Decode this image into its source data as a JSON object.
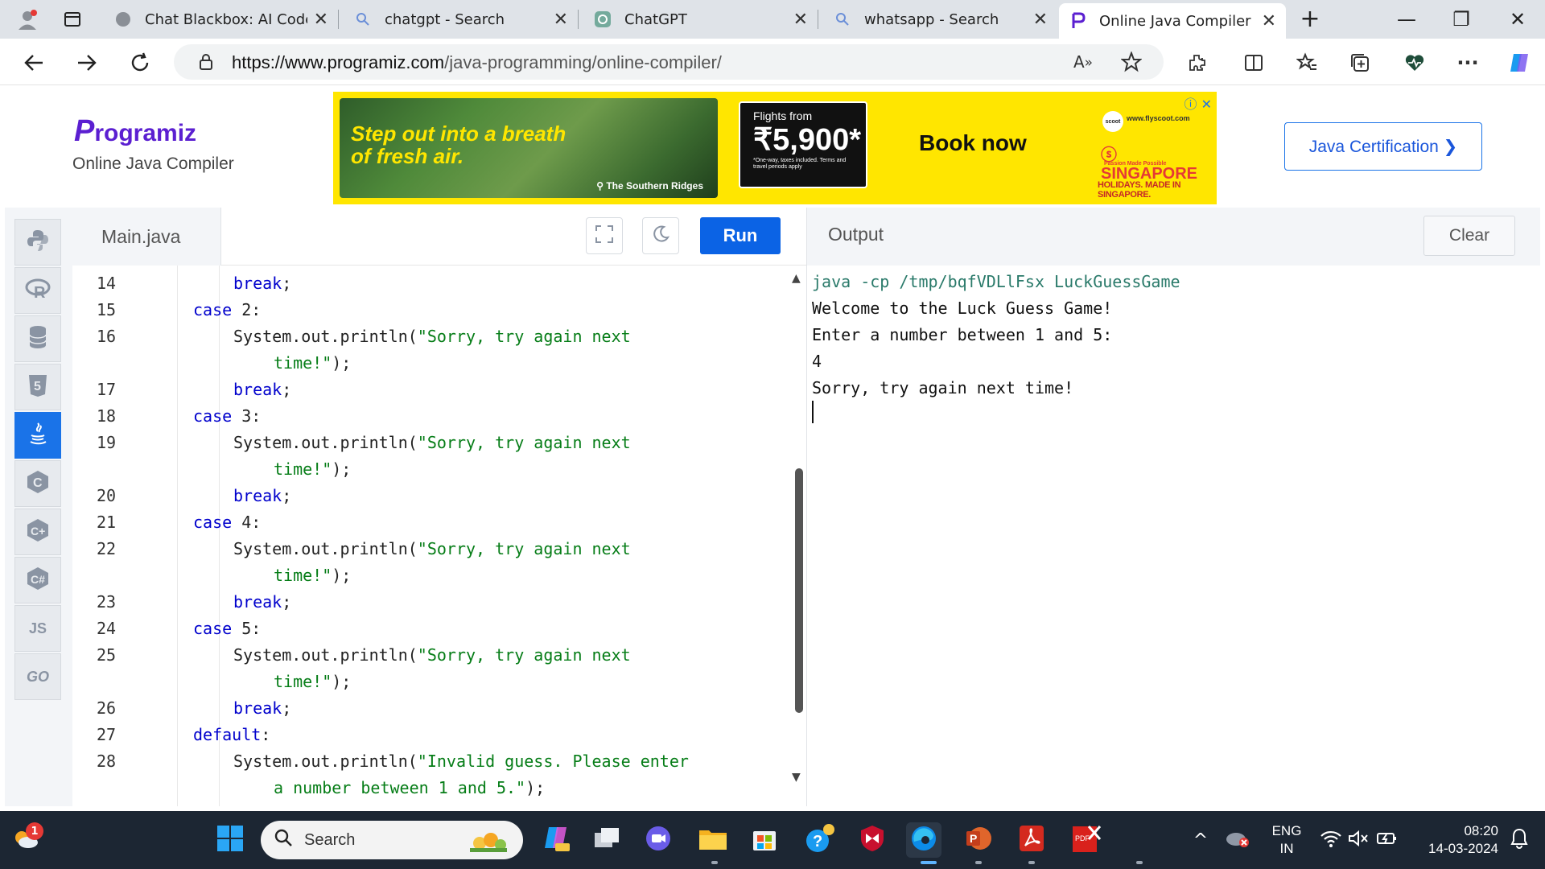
{
  "browser": {
    "tabs": [
      {
        "label": "Chat Blackbox: AI Code C",
        "icon": "blackbox-icon"
      },
      {
        "label": "chatgpt - Search",
        "icon": "search-icon"
      },
      {
        "label": "ChatGPT",
        "icon": "chatgpt-icon"
      },
      {
        "label": "whatsapp - Search",
        "icon": "search-icon"
      },
      {
        "label": "Online Java Compiler",
        "icon": "programiz-icon",
        "active": true
      }
    ],
    "url_host": "https://www.programiz.com",
    "url_path": "/java-programming/online-compiler/"
  },
  "header": {
    "logo_p": "P",
    "logo_rest": "rogramiz",
    "subtitle": "Online Java Compiler",
    "cert_button": "Java Certification ❯"
  },
  "ad": {
    "headline": "Step out into a breath of fresh air.",
    "location": "The Southern Ridges",
    "flights_from": "Flights from",
    "price": "₹5,900*",
    "fine_print": "*One-way, taxes included. Terms and travel periods apply",
    "cta": "Book now",
    "scoot": "scoot",
    "brand_url": "www.flyscoot.com",
    "brand": "SINGAPORE",
    "brand_tag": "Passion Made Possible",
    "holidays": "HOLIDAYS. MADE IN SINGAPORE."
  },
  "sidebar": {
    "languages": [
      {
        "name": "python",
        "icon": "python-icon"
      },
      {
        "name": "r",
        "icon": "r-icon"
      },
      {
        "name": "sql",
        "icon": "database-icon"
      },
      {
        "name": "html",
        "icon": "html5-icon"
      },
      {
        "name": "java",
        "icon": "java-icon",
        "active": true
      },
      {
        "name": "c",
        "icon": "c-icon"
      },
      {
        "name": "cpp",
        "icon": "cpp-icon"
      },
      {
        "name": "csharp",
        "icon": "csharp-icon"
      },
      {
        "name": "javascript",
        "label": "JS"
      },
      {
        "name": "go",
        "label": "GO"
      }
    ]
  },
  "editor": {
    "file_name": "Main.java",
    "run_label": "Run",
    "lines": [
      {
        "n": "14",
        "indent": 2,
        "parts": [
          [
            "kw",
            "break"
          ],
          [
            "p",
            ";"
          ]
        ]
      },
      {
        "n": "15",
        "indent": 1,
        "parts": [
          [
            "kw",
            "case"
          ],
          [
            "p",
            " 2:"
          ]
        ]
      },
      {
        "n": "16",
        "indent": 2,
        "parts": [
          [
            "p",
            "System.out.println("
          ],
          [
            "str",
            "\"Sorry, try again next"
          ]
        ]
      },
      {
        "n": "",
        "indent": 3,
        "parts": [
          [
            "str",
            "time!\""
          ],
          [
            "p",
            ");"
          ]
        ]
      },
      {
        "n": "17",
        "indent": 2,
        "parts": [
          [
            "kw",
            "break"
          ],
          [
            "p",
            ";"
          ]
        ]
      },
      {
        "n": "18",
        "indent": 1,
        "parts": [
          [
            "kw",
            "case"
          ],
          [
            "p",
            " 3:"
          ]
        ]
      },
      {
        "n": "19",
        "indent": 2,
        "parts": [
          [
            "p",
            "System.out.println("
          ],
          [
            "str",
            "\"Sorry, try again next"
          ]
        ]
      },
      {
        "n": "",
        "indent": 3,
        "parts": [
          [
            "str",
            "time!\""
          ],
          [
            "p",
            ");"
          ]
        ]
      },
      {
        "n": "20",
        "indent": 2,
        "parts": [
          [
            "kw",
            "break"
          ],
          [
            "p",
            ";"
          ]
        ]
      },
      {
        "n": "21",
        "indent": 1,
        "parts": [
          [
            "kw",
            "case"
          ],
          [
            "p",
            " 4:"
          ]
        ]
      },
      {
        "n": "22",
        "indent": 2,
        "parts": [
          [
            "p",
            "System.out.println("
          ],
          [
            "str",
            "\"Sorry, try again next"
          ]
        ]
      },
      {
        "n": "",
        "indent": 3,
        "parts": [
          [
            "str",
            "time!\""
          ],
          [
            "p",
            ");"
          ]
        ]
      },
      {
        "n": "23",
        "indent": 2,
        "parts": [
          [
            "kw",
            "break"
          ],
          [
            "p",
            ";"
          ]
        ]
      },
      {
        "n": "24",
        "indent": 1,
        "parts": [
          [
            "kw",
            "case"
          ],
          [
            "p",
            " 5:"
          ]
        ]
      },
      {
        "n": "25",
        "indent": 2,
        "parts": [
          [
            "p",
            "System.out.println("
          ],
          [
            "str",
            "\"Sorry, try again next"
          ]
        ]
      },
      {
        "n": "",
        "indent": 3,
        "parts": [
          [
            "str",
            "time!\""
          ],
          [
            "p",
            ");"
          ]
        ]
      },
      {
        "n": "26",
        "indent": 2,
        "parts": [
          [
            "kw",
            "break"
          ],
          [
            "p",
            ";"
          ]
        ]
      },
      {
        "n": "27",
        "indent": 1,
        "parts": [
          [
            "kw",
            "default"
          ],
          [
            "p",
            ":"
          ]
        ]
      },
      {
        "n": "28",
        "indent": 2,
        "parts": [
          [
            "p",
            "System.out.println("
          ],
          [
            "str",
            "\"Invalid guess. Please enter"
          ]
        ]
      },
      {
        "n": "",
        "indent": 3,
        "parts": [
          [
            "str",
            "a number between 1 and 5.\""
          ],
          [
            "p",
            ");"
          ]
        ]
      }
    ]
  },
  "output": {
    "title": "Output",
    "clear_label": "Clear",
    "lines": [
      {
        "text": "java -cp /tmp/bqfVDLlFsx LuckGuessGame",
        "kind": "cmd"
      },
      {
        "text": "Welcome to the Luck Guess Game!",
        "kind": "out"
      },
      {
        "text": "Enter a number between 1 and 5:",
        "kind": "out"
      },
      {
        "text": "4",
        "kind": "out"
      },
      {
        "text": "Sorry, try again next time!",
        "kind": "out"
      }
    ]
  },
  "taskbar": {
    "weather_badge": "1",
    "search_placeholder": "Search",
    "lang_top": "ENG",
    "lang_bottom": "IN",
    "time": "08:20",
    "date": "14-03-2024"
  },
  "colors": {
    "accent": "#1a73e8",
    "run": "#0b63e5",
    "keyword": "#0000cc",
    "string": "#067d17",
    "ad_bg": "#ffe600"
  }
}
